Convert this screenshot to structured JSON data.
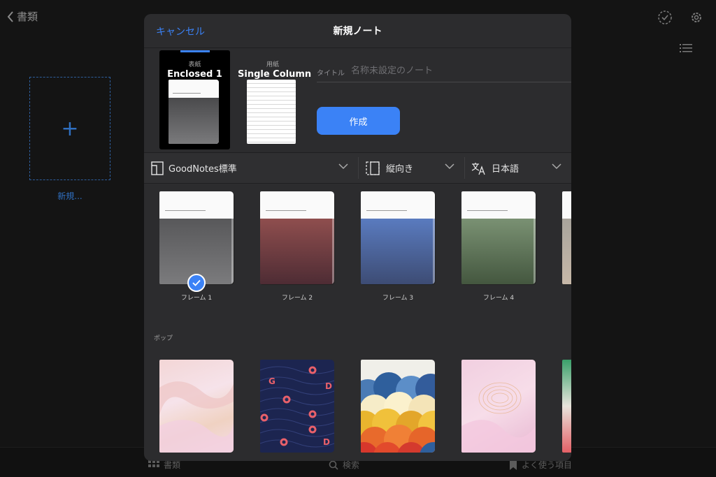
{
  "background": {
    "back_label": "書類",
    "new_tile_label": "新規...",
    "tabs": [
      {
        "label": "書類",
        "icon": "grid-icon"
      },
      {
        "label": "検索",
        "icon": "search-icon"
      },
      {
        "label": "よく使う項目",
        "icon": "bookmark-icon"
      }
    ]
  },
  "modal": {
    "cancel_label": "キャンセル",
    "title": "新規ノート",
    "cover_option": {
      "small": "表紙",
      "name": "Enclosed 1"
    },
    "paper_option": {
      "small": "用紙",
      "name": "Single Column"
    },
    "title_field": {
      "label": "タイトル",
      "placeholder": "名称未設定のノート",
      "value": ""
    },
    "create_label": "作成",
    "filters": {
      "template_set": "GoodNotes標準",
      "orientation": "縦向き",
      "language": "日本語"
    },
    "frame_covers": [
      {
        "label": "フレーム 1",
        "color_top": "#58585a",
        "color_bottom": "#7b7b7d",
        "selected": true
      },
      {
        "label": "フレーム 2",
        "color_top": "#8f4e4e",
        "color_bottom": "#4e2c34",
        "selected": false
      },
      {
        "label": "フレーム 3",
        "color_top": "#5a7bbf",
        "color_bottom": "#3d4c74",
        "selected": false
      },
      {
        "label": "フレーム 4",
        "color_top": "#7a9173",
        "color_bottom": "#44573f",
        "selected": false
      }
    ],
    "section_pop": "ポップ"
  },
  "colors": {
    "accent": "#3b82f6",
    "modal_bg": "#2c2c2e",
    "page_bg": "#141414"
  }
}
